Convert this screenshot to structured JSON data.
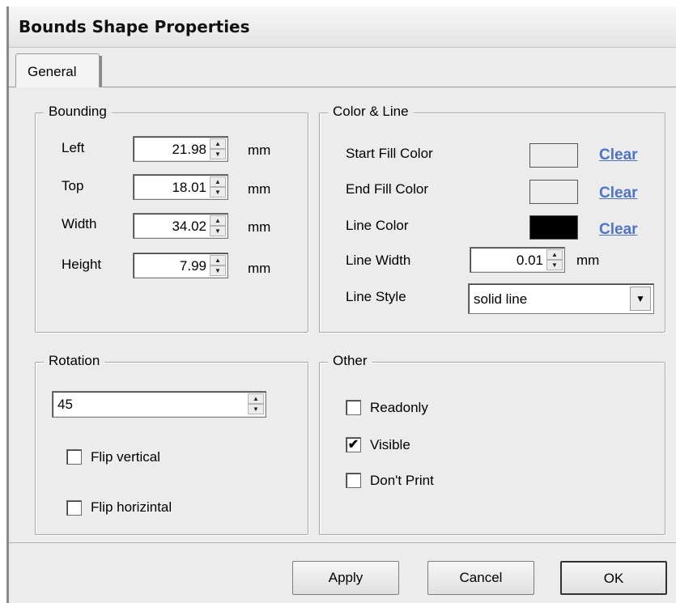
{
  "window": {
    "title": "Bounds Shape Properties"
  },
  "tabs": [
    {
      "label": "General"
    }
  ],
  "bounding": {
    "legend": "Bounding",
    "unit": "mm",
    "fields": [
      {
        "label": "Left",
        "value": "21.98"
      },
      {
        "label": "Top",
        "value": "18.01"
      },
      {
        "label": "Width",
        "value": "34.02"
      },
      {
        "label": "Height",
        "value": "7.99"
      }
    ]
  },
  "color_line": {
    "legend": "Color & Line",
    "clear_label": "Clear",
    "start_fill": {
      "label": "Start Fill Color",
      "color": "#ececec"
    },
    "end_fill": {
      "label": "End Fill Color",
      "color": "#ececec"
    },
    "line_color": {
      "label": "Line Color",
      "color": "#000000"
    },
    "line_width": {
      "label": "Line Width",
      "value": "0.01",
      "unit": "mm"
    },
    "line_style": {
      "label": "Line Style",
      "value": "solid line"
    }
  },
  "rotation": {
    "legend": "Rotation",
    "value": "45",
    "flip_vertical": {
      "label": "Flip vertical",
      "checked": false
    },
    "flip_horizontal": {
      "label": "Flip horizintal",
      "checked": false
    }
  },
  "other": {
    "legend": "Other",
    "readonly": {
      "label": "Readonly",
      "checked": false
    },
    "visible": {
      "label": "Visible",
      "checked": true
    },
    "dont_print": {
      "label": "Don't Print",
      "checked": false
    }
  },
  "buttons": {
    "apply": "Apply",
    "cancel": "Cancel",
    "ok": "OK"
  }
}
